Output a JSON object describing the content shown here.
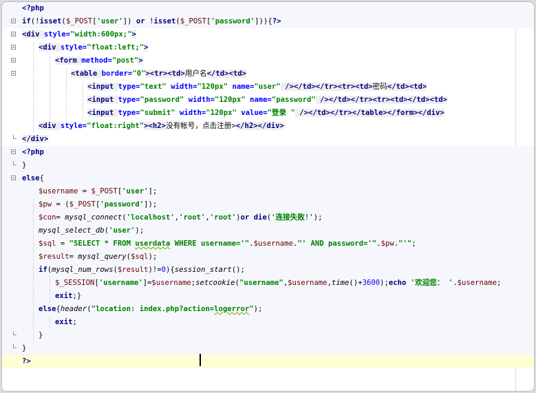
{
  "editor": {
    "lines": [
      {
        "kind": "php",
        "fold": "none",
        "tokens": [
          {
            "c": "k",
            "x": "<?php"
          }
        ]
      },
      {
        "kind": "php",
        "fold": "open",
        "tokens": [
          {
            "c": "k",
            "x": "if"
          },
          {
            "c": "p",
            "x": "(!"
          },
          {
            "c": "k",
            "x": "isset"
          },
          {
            "c": "p",
            "x": "("
          },
          {
            "c": "v",
            "x": "$_POST"
          },
          {
            "c": "p",
            "x": "["
          },
          {
            "c": "s",
            "x": "'user'"
          },
          {
            "c": "p",
            "x": "]) "
          },
          {
            "c": "k",
            "x": "or"
          },
          {
            "c": "p",
            "x": " !"
          },
          {
            "c": "k",
            "x": "isset"
          },
          {
            "c": "p",
            "x": "("
          },
          {
            "c": "v",
            "x": "$_POST"
          },
          {
            "c": "p",
            "x": "["
          },
          {
            "c": "s",
            "x": "'password'"
          },
          {
            "c": "p",
            "x": "])){"
          },
          {
            "c": "k",
            "x": "?>"
          }
        ]
      },
      {
        "kind": "html",
        "fold": "open",
        "tokens": [
          {
            "c": "t",
            "x": "<div "
          },
          {
            "c": "a",
            "x": "style="
          },
          {
            "c": "s",
            "x": "\"width:600px;\""
          },
          {
            "c": "t",
            "x": ">"
          }
        ]
      },
      {
        "kind": "html",
        "fold": "open",
        "tokens": [
          {
            "c": "t",
            "x": "<div "
          },
          {
            "c": "a",
            "x": "style="
          },
          {
            "c": "s",
            "x": "\"float:left;\""
          },
          {
            "c": "t",
            "x": ">"
          }
        ]
      },
      {
        "kind": "html",
        "fold": "open",
        "tokens": [
          {
            "c": "t",
            "x": "<form "
          },
          {
            "c": "a",
            "x": "method="
          },
          {
            "c": "s",
            "x": "\"post\""
          },
          {
            "c": "t",
            "x": ">"
          }
        ]
      },
      {
        "kind": "html",
        "fold": "open",
        "tokens": [
          {
            "c": "t",
            "x": "<table "
          },
          {
            "c": "a",
            "x": "border="
          },
          {
            "c": "s",
            "x": "\"0\""
          },
          {
            "c": "t",
            "x": "><tr><td>"
          },
          {
            "c": "z",
            "x": "用户名"
          },
          {
            "c": "t",
            "x": "</td><td>"
          }
        ]
      },
      {
        "kind": "html",
        "fold": "none",
        "tokens": [
          {
            "c": "t",
            "x": "<input "
          },
          {
            "c": "a",
            "x": "type="
          },
          {
            "c": "s",
            "x": "\"text\""
          },
          {
            "c": "a",
            "x": " width="
          },
          {
            "c": "s",
            "x": "\"120px\""
          },
          {
            "c": "a",
            "x": " name="
          },
          {
            "c": "s",
            "x": "\"user\""
          },
          {
            "c": "t",
            "x": " /></td></tr><tr><td>"
          },
          {
            "c": "z",
            "x": "密码"
          },
          {
            "c": "t",
            "x": "</td><td>"
          }
        ]
      },
      {
        "kind": "html",
        "fold": "none",
        "tokens": [
          {
            "c": "t",
            "x": "<input "
          },
          {
            "c": "a",
            "x": "type="
          },
          {
            "c": "s",
            "x": "\"password\""
          },
          {
            "c": "a",
            "x": " width="
          },
          {
            "c": "s",
            "x": "\"120px\""
          },
          {
            "c": "a",
            "x": " name="
          },
          {
            "c": "s",
            "x": "\"password\""
          },
          {
            "c": "t",
            "x": " /></td></tr><tr><td></td><td>"
          }
        ]
      },
      {
        "kind": "html",
        "fold": "none",
        "tokens": [
          {
            "c": "t",
            "x": "<input "
          },
          {
            "c": "a",
            "x": "type="
          },
          {
            "c": "s",
            "x": "\"submit\""
          },
          {
            "c": "a",
            "x": " width="
          },
          {
            "c": "s",
            "x": "\"120px\""
          },
          {
            "c": "a",
            "x": " value="
          },
          {
            "c": "s",
            "x": "\"登录 \""
          },
          {
            "c": "t",
            "x": " /></td></tr></table></form></div>"
          }
        ]
      },
      {
        "kind": "html",
        "fold": "none",
        "tokens": [
          {
            "c": "t",
            "x": "<div "
          },
          {
            "c": "a",
            "x": "style="
          },
          {
            "c": "s",
            "x": "\"float:right\""
          },
          {
            "c": "t",
            "x": "><h2>"
          },
          {
            "c": "z",
            "x": "没有帐号，点击注册>"
          },
          {
            "c": "t",
            "x": "</h2></div>"
          }
        ]
      },
      {
        "kind": "html",
        "fold": "end",
        "tokens": [
          {
            "c": "t",
            "x": "</div>"
          }
        ]
      },
      {
        "kind": "php",
        "fold": "open",
        "tokens": [
          {
            "c": "k",
            "x": "<?php"
          }
        ]
      },
      {
        "kind": "php",
        "fold": "end",
        "tokens": [
          {
            "c": "p",
            "x": "}"
          }
        ]
      },
      {
        "kind": "php",
        "fold": "open",
        "tokens": [
          {
            "c": "k",
            "x": "else"
          },
          {
            "c": "p",
            "x": "{"
          }
        ]
      },
      {
        "kind": "php",
        "fold": "none",
        "tokens": [
          {
            "c": "v",
            "x": "$username"
          },
          {
            "c": "p",
            "x": " = "
          },
          {
            "c": "v",
            "x": "$_POST"
          },
          {
            "c": "p",
            "x": "["
          },
          {
            "c": "s",
            "x": "'user'"
          },
          {
            "c": "p",
            "x": "];"
          }
        ]
      },
      {
        "kind": "php",
        "fold": "none",
        "tokens": [
          {
            "c": "v",
            "x": "$pw"
          },
          {
            "c": "p",
            "x": " = ("
          },
          {
            "c": "v",
            "x": "$_POST"
          },
          {
            "c": "p",
            "x": "["
          },
          {
            "c": "s",
            "x": "'password'"
          },
          {
            "c": "p",
            "x": "]);"
          }
        ]
      },
      {
        "kind": "php",
        "fold": "none",
        "tokens": [
          {
            "c": "v",
            "x": "$con"
          },
          {
            "c": "p",
            "x": "= "
          },
          {
            "c": "f",
            "x": "mysql_connect"
          },
          {
            "c": "p",
            "x": "("
          },
          {
            "c": "s",
            "x": "'localhost'"
          },
          {
            "c": "p",
            "x": ","
          },
          {
            "c": "s",
            "x": "'root'"
          },
          {
            "c": "p",
            "x": ","
          },
          {
            "c": "s",
            "x": "'root'"
          },
          {
            "c": "p",
            "x": ")"
          },
          {
            "c": "k",
            "x": "or die"
          },
          {
            "c": "p",
            "x": "("
          },
          {
            "c": "s",
            "x": "'连接失败!'"
          },
          {
            "c": "p",
            "x": ");"
          }
        ]
      },
      {
        "kind": "php",
        "fold": "none",
        "tokens": [
          {
            "c": "f",
            "x": "mysql_select_db"
          },
          {
            "c": "p",
            "x": "("
          },
          {
            "c": "s",
            "x": "'user'"
          },
          {
            "c": "p",
            "x": ");"
          }
        ]
      },
      {
        "kind": "php",
        "fold": "none",
        "tokens": [
          {
            "c": "v",
            "x": "$sql"
          },
          {
            "c": "p",
            "x": " = "
          },
          {
            "c": "s",
            "x": "\"SELECT * FROM "
          },
          {
            "c": "s u",
            "x": "userdata"
          },
          {
            "c": "s",
            "x": " WHERE username='\""
          },
          {
            "c": "p",
            "x": "."
          },
          {
            "c": "v",
            "x": "$username"
          },
          {
            "c": "p",
            "x": "."
          },
          {
            "c": "s",
            "x": "\"' AND password='\""
          },
          {
            "c": "p",
            "x": "."
          },
          {
            "c": "v",
            "x": "$pw"
          },
          {
            "c": "p",
            "x": "."
          },
          {
            "c": "s",
            "x": "\"'\""
          },
          {
            "c": "p",
            "x": ";"
          }
        ]
      },
      {
        "kind": "php",
        "fold": "none",
        "tokens": [
          {
            "c": "v",
            "x": "$result"
          },
          {
            "c": "p",
            "x": "= "
          },
          {
            "c": "f",
            "x": "mysql_query"
          },
          {
            "c": "p",
            "x": "("
          },
          {
            "c": "v",
            "x": "$sql"
          },
          {
            "c": "p",
            "x": ");"
          }
        ]
      },
      {
        "kind": "php",
        "fold": "none",
        "tokens": [
          {
            "c": "k",
            "x": "if"
          },
          {
            "c": "p",
            "x": "("
          },
          {
            "c": "f",
            "x": "mysql_num_rows"
          },
          {
            "c": "p",
            "x": "("
          },
          {
            "c": "v",
            "x": "$result"
          },
          {
            "c": "p",
            "x": ")!="
          },
          {
            "c": "n",
            "x": "0"
          },
          {
            "c": "p",
            "x": "){"
          },
          {
            "c": "f",
            "x": "session_start"
          },
          {
            "c": "p",
            "x": "();"
          }
        ]
      },
      {
        "kind": "php",
        "fold": "none",
        "tokens": [
          {
            "c": "v",
            "x": "$_SESSION"
          },
          {
            "c": "p",
            "x": "["
          },
          {
            "c": "s",
            "x": "'username'"
          },
          {
            "c": "p",
            "x": "]="
          },
          {
            "c": "v",
            "x": "$username"
          },
          {
            "c": "p",
            "x": ";"
          },
          {
            "c": "f",
            "x": "setcookie"
          },
          {
            "c": "p",
            "x": "("
          },
          {
            "c": "s",
            "x": "\"username\""
          },
          {
            "c": "p",
            "x": ","
          },
          {
            "c": "v",
            "x": "$username"
          },
          {
            "c": "p",
            "x": ","
          },
          {
            "c": "f",
            "x": "time"
          },
          {
            "c": "p",
            "x": "()+"
          },
          {
            "c": "n",
            "x": "3600"
          },
          {
            "c": "p",
            "x": ");"
          },
          {
            "c": "k",
            "x": "echo"
          },
          {
            "c": "s",
            "x": " '欢迎您： '"
          },
          {
            "c": "p",
            "x": "."
          },
          {
            "c": "v",
            "x": "$username"
          },
          {
            "c": "p",
            "x": ";"
          }
        ]
      },
      {
        "kind": "php",
        "fold": "none",
        "tokens": [
          {
            "c": "k",
            "x": "exit"
          },
          {
            "c": "p",
            "x": ";}"
          }
        ]
      },
      {
        "kind": "php",
        "fold": "none",
        "tokens": [
          {
            "c": "k",
            "x": "else"
          },
          {
            "c": "p",
            "x": "{"
          },
          {
            "c": "f",
            "x": "header"
          },
          {
            "c": "p",
            "x": "("
          },
          {
            "c": "s",
            "x": "\"location: index.php?action="
          },
          {
            "c": "s u",
            "x": "logerror"
          },
          {
            "c": "s",
            "x": "\""
          },
          {
            "c": "p",
            "x": ");"
          }
        ]
      },
      {
        "kind": "php",
        "fold": "none",
        "tokens": [
          {
            "c": "k",
            "x": "exit"
          },
          {
            "c": "p",
            "x": ";"
          }
        ]
      },
      {
        "kind": "php",
        "fold": "end",
        "tokens": [
          {
            "c": "p",
            "x": "}"
          }
        ]
      },
      {
        "kind": "php",
        "fold": "end",
        "tokens": [
          {
            "c": "p",
            "x": "}"
          }
        ]
      },
      {
        "kind": "current",
        "fold": "none",
        "tokens": [
          {
            "c": "k",
            "x": "?>"
          }
        ]
      }
    ],
    "colors": {
      "php_line_bg": "#f5f7fc",
      "current_line_bg": "#ffffd6",
      "keyword": "#000080",
      "string": "#008000",
      "attribute": "#0000ff",
      "variable": "#660000"
    }
  }
}
